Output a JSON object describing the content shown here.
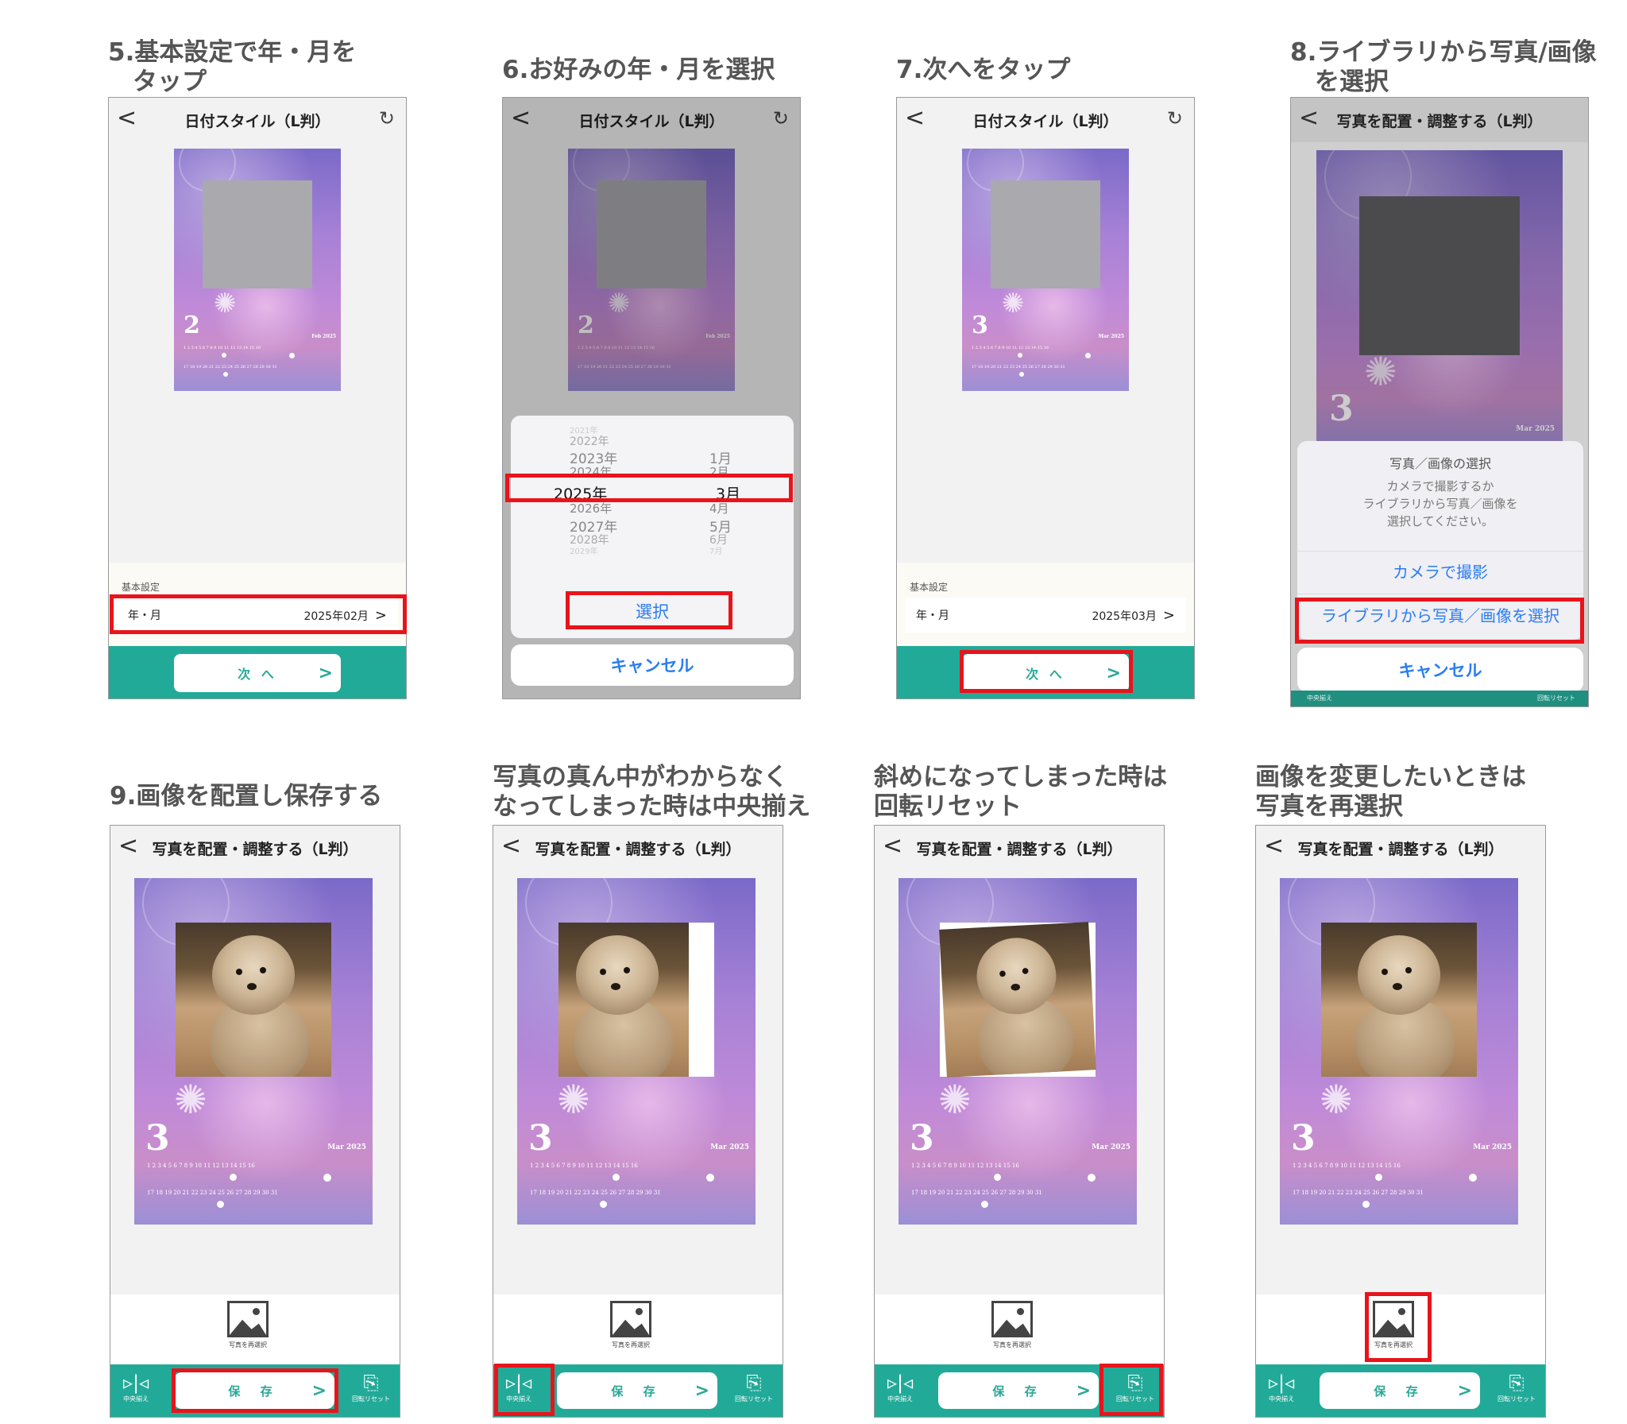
{
  "colors": {
    "accent_green": "#22aa99",
    "highlight_red": "#e8141b",
    "ios_blue": "#2a7df2"
  },
  "captions": {
    "p5": "5.基本設定で年・月を\n　タップ",
    "p6": "6.お好みの年・月を選択",
    "p7": "7.次へをタップ",
    "p8": "8.ライブラリから写真/画像\n　を選択",
    "p9": "9.画像を配置し保存する",
    "p10": "写真の真ん中がわからなく\nなってしまった時は中央揃え",
    "p11": "斜めになってしまった時は\n回転リセット",
    "p12": "画像を変更したいときは\n写真を再選択"
  },
  "nav": {
    "back": "<",
    "title_date": "日付スタイル（L判）",
    "title_place": "写真を配置・調整する（L判）",
    "reload_icon": "reload-icon"
  },
  "calendar": {
    "feb": {
      "number": "2",
      "month": "Feb 2025"
    },
    "mar": {
      "number": "3",
      "month": "Mar 2025"
    },
    "days_row1": "1 2 3 4 5 6 7 8 9 10 11 12 13 14 15 16",
    "days_row2": "17 18 19 20 21 22 23 24 25 26 27 28 29 30 31"
  },
  "settings": {
    "section": "基本設定",
    "row_label": "年・月",
    "value_feb": "2025年02月",
    "value_mar": "2025年03月",
    "chevron": ">"
  },
  "next_button": {
    "label": "次 へ",
    "chevron": ">"
  },
  "picker": {
    "years": [
      "2021年",
      "2022年",
      "2023年",
      "2024年",
      "2025年",
      "2026年",
      "2027年",
      "2028年",
      "2029年"
    ],
    "months": [
      "1月",
      "2月",
      "3月",
      "4月",
      "5月",
      "6月",
      "7月"
    ],
    "select": "選択",
    "cancel": "キャンセル"
  },
  "action_sheet": {
    "title": "写真／画像の選択",
    "message1": "カメラで撮影するか",
    "message2": "ライブラリから写真／画像を",
    "message3": "選択してください。",
    "camera": "カメラで撮影",
    "library": "ライブラリから写真／画像を選択",
    "cancel": "キャンセル",
    "under_left": "中央揃え",
    "under_right": "回転リセット"
  },
  "editor": {
    "reselect": "写真を再選択",
    "center": "中央揃え",
    "save": "保 存",
    "rotate_reset": "回転リセット",
    "center_icon": "center-align-icon",
    "rotate_icon": "rotate-reset-icon",
    "image_icon": "image-icon"
  }
}
